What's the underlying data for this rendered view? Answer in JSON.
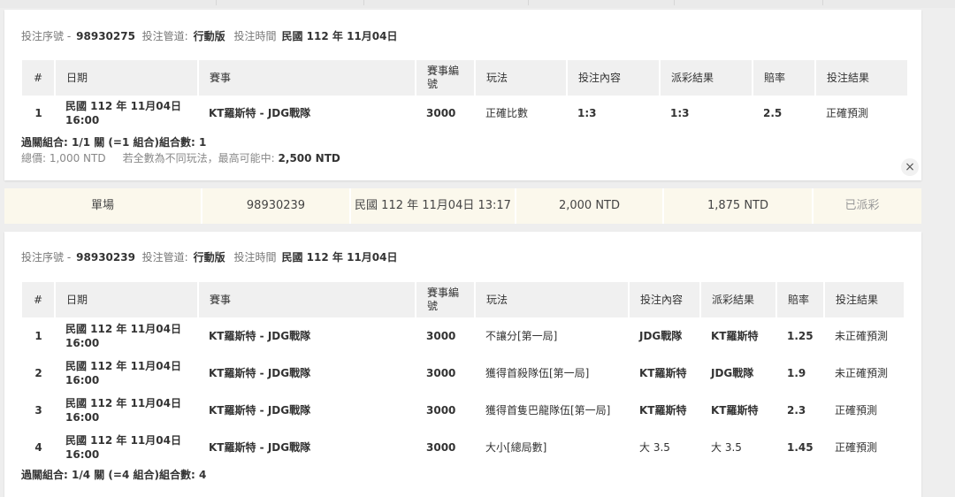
{
  "panel1": {
    "meta": {
      "serial_label": "投注序號 -",
      "serial": "98930275",
      "channel_label": "投注管道:",
      "channel": "行動版",
      "time_label": "投注時間",
      "time": "民國 112 年 11月04日"
    },
    "headers": [
      "#",
      "日期",
      "賽事",
      "賽事編號",
      "玩法",
      "投注內容",
      "派彩結果",
      "賠率",
      "投注結果"
    ],
    "rows": [
      {
        "no": "1",
        "date": "民國 112 年 11月04日",
        "time": "16:00",
        "match": "KT羅斯特 - JDG戰隊",
        "match_no": "3000",
        "play": "正確比數",
        "bet": "1:3",
        "result": "1:3",
        "odds": "2.5",
        "outcome": "正確預測"
      }
    ],
    "combo": "過關組合: 1/1 關 (=1 組合)組合數: 1",
    "total_label": "總價: 1,000 NTD",
    "note": "若全數為不同玩法，最高可能中:",
    "max_win": "2,500 NTD",
    "close_icon": "×"
  },
  "summary_row": {
    "type": "單場",
    "serial": "98930239",
    "datetime": "民國 112 年 11月04日 13:17",
    "stake": "2,000 NTD",
    "payout": "1,875 NTD",
    "status": "已派彩"
  },
  "panel2": {
    "meta": {
      "serial_label": "投注序號 -",
      "serial": "98930239",
      "channel_label": "投注管道:",
      "channel": "行動版",
      "time_label": "投注時間",
      "time": "民國 112 年 11月04日"
    },
    "headers": [
      "#",
      "日期",
      "賽事",
      "賽事編號",
      "玩法",
      "投注內容",
      "派彩結果",
      "賠率",
      "投注結果"
    ],
    "rows": [
      {
        "no": "1",
        "date": "民國 112 年 11月04日",
        "time": "16:00",
        "match": "KT羅斯特 - JDG戰隊",
        "match_no": "3000",
        "play": "不讓分[第一局]",
        "bet": "JDG戰隊",
        "result": "KT羅斯特",
        "odds": "1.25",
        "outcome": "未正確預測"
      },
      {
        "no": "2",
        "date": "民國 112 年 11月04日",
        "time": "16:00",
        "match": "KT羅斯特 - JDG戰隊",
        "match_no": "3000",
        "play": "獲得首殺隊伍[第一局]",
        "bet": "KT羅斯特",
        "result": "JDG戰隊",
        "odds": "1.9",
        "outcome": "未正確預測"
      },
      {
        "no": "3",
        "date": "民國 112 年 11月04日",
        "time": "16:00",
        "match": "KT羅斯特 - JDG戰隊",
        "match_no": "3000",
        "play": "獲得首隻巴龍隊伍[第一局]",
        "bet": "KT羅斯特",
        "result": "KT羅斯特",
        "odds": "2.3",
        "outcome": "正確預測"
      },
      {
        "no": "4",
        "date": "民國 112 年 11月04日",
        "time": "16:00",
        "match": "KT羅斯特 - JDG戰隊",
        "match_no": "3000",
        "play": "大小[總局數]",
        "bet": "大 3.5",
        "result": "大 3.5",
        "odds": "1.45",
        "outcome": "正確預測"
      }
    ],
    "combo": "過關組合: 1/4 關 (=4 組合)組合數: 4"
  }
}
